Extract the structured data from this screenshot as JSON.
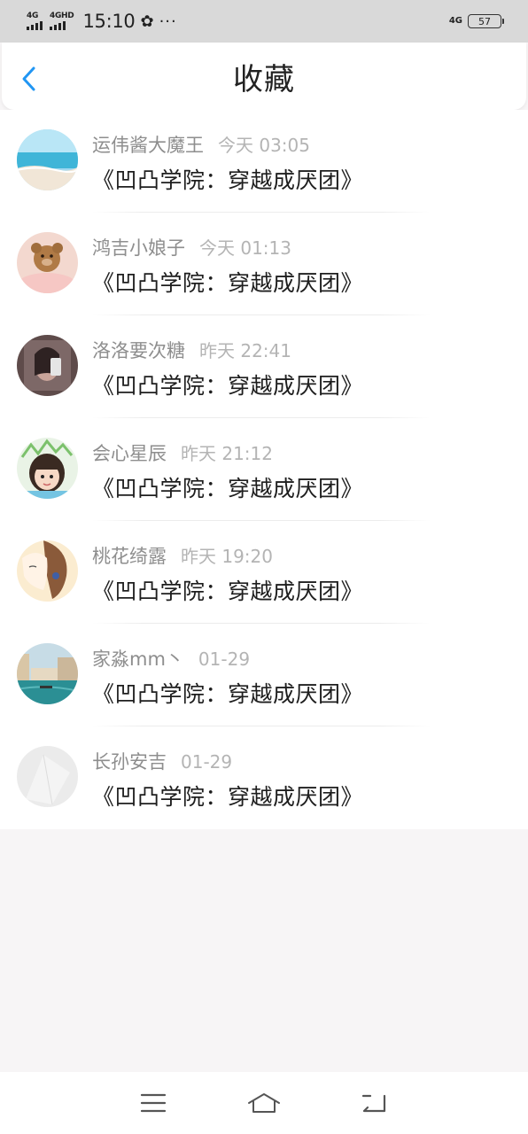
{
  "status_bar": {
    "signal1_label": "4G",
    "signal2_label": "4GHD",
    "time": "15:10",
    "pin_icon": "✿",
    "more": "···",
    "net_right": "4G",
    "battery": "57"
  },
  "header": {
    "title": "收藏",
    "back_icon": "chevron-left-icon",
    "accent": "#2196f3"
  },
  "favorites": [
    {
      "user": "运伟酱大魔王",
      "time": "今天 03:05",
      "title": "《凹凸学院：穿越成厌团》",
      "avatar": "beach"
    },
    {
      "user": "鸿吉小娘子",
      "time": "今天 01:13",
      "title": "《凹凸学院：穿越成厌团》",
      "avatar": "teddy-bear"
    },
    {
      "user": "洛洛要次糖",
      "time": "昨天 22:41",
      "title": "《凹凸学院：穿越成厌团》",
      "avatar": "mirror-selfie"
    },
    {
      "user": "会心星辰",
      "time": "昨天 21:12",
      "title": "《凹凸学院：穿越成厌团》",
      "avatar": "child"
    },
    {
      "user": "桃花绮露",
      "time": "昨天 19:20",
      "title": "《凹凸学院：穿越成厌团》",
      "avatar": "illustration-girl"
    },
    {
      "user": "家淼mm丶",
      "time": "01-29",
      "title": "《凹凸学院：穿越成厌团》",
      "avatar": "venice"
    },
    {
      "user": "长孙安吉",
      "time": "01-29",
      "title": "《凹凸学院：穿越成厌团》",
      "avatar": "blank"
    }
  ],
  "nav_bar": {
    "menu_icon": "menu-icon",
    "home_icon": "home-icon",
    "back_icon": "back-icon"
  }
}
